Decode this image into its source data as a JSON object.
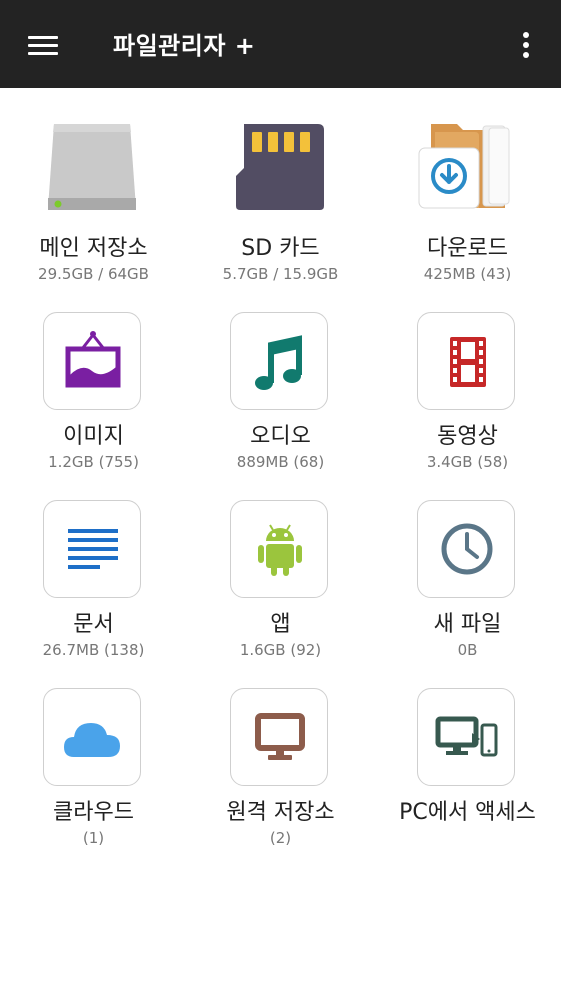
{
  "app_bar": {
    "title": "파일관리자 +",
    "menu_icon": "hamburger-menu-icon",
    "more_icon": "more-vertical-icon"
  },
  "colors": {
    "app_bar_bg": "#232323",
    "storage_gray": "#c9c9c9",
    "sd_card": "#524d63",
    "sd_contacts": "#f3c13a",
    "folder": "#e2a861",
    "download_accent": "#2a8bc7",
    "image_purple": "#7a1fa2",
    "audio_teal": "#117a6e",
    "video_red": "#c62828",
    "document_blue": "#1e6fc8",
    "android_green": "#9bc53d",
    "clock_slate": "#5a7688",
    "cloud_blue": "#4aa3ea",
    "monitor_brown": "#8d5c4b",
    "pc_teal": "#37594f"
  },
  "items": [
    {
      "id": "main-storage",
      "label": "메인 저장소",
      "sub": "29.5GB / 64GB",
      "icon": "hard-drive-icon"
    },
    {
      "id": "sd-card",
      "label": "SD 카드",
      "sub": "5.7GB / 15.9GB",
      "icon": "sd-card-icon"
    },
    {
      "id": "download",
      "label": "다운로드",
      "sub": "425MB (43)",
      "icon": "download-folder-icon"
    },
    {
      "id": "images",
      "label": "이미지",
      "sub": "1.2GB (755)",
      "icon": "picture-frame-icon"
    },
    {
      "id": "audio",
      "label": "오디오",
      "sub": "889MB (68)",
      "icon": "music-note-icon"
    },
    {
      "id": "video",
      "label": "동영상",
      "sub": "3.4GB (58)",
      "icon": "film-strip-icon"
    },
    {
      "id": "documents",
      "label": "문서",
      "sub": "26.7MB (138)",
      "icon": "document-lines-icon"
    },
    {
      "id": "apps",
      "label": "앱",
      "sub": "1.6GB (92)",
      "icon": "android-icon"
    },
    {
      "id": "new-files",
      "label": "새 파일",
      "sub": "0B",
      "icon": "clock-icon"
    },
    {
      "id": "cloud",
      "label": "클라우드",
      "sub": "(1)",
      "icon": "cloud-icon"
    },
    {
      "id": "remote-storage",
      "label": "원격 저장소",
      "sub": "(2)",
      "icon": "monitor-icon"
    },
    {
      "id": "pc-access",
      "label": "PC에서 액세스",
      "sub": "",
      "icon": "pc-phone-icon"
    }
  ]
}
